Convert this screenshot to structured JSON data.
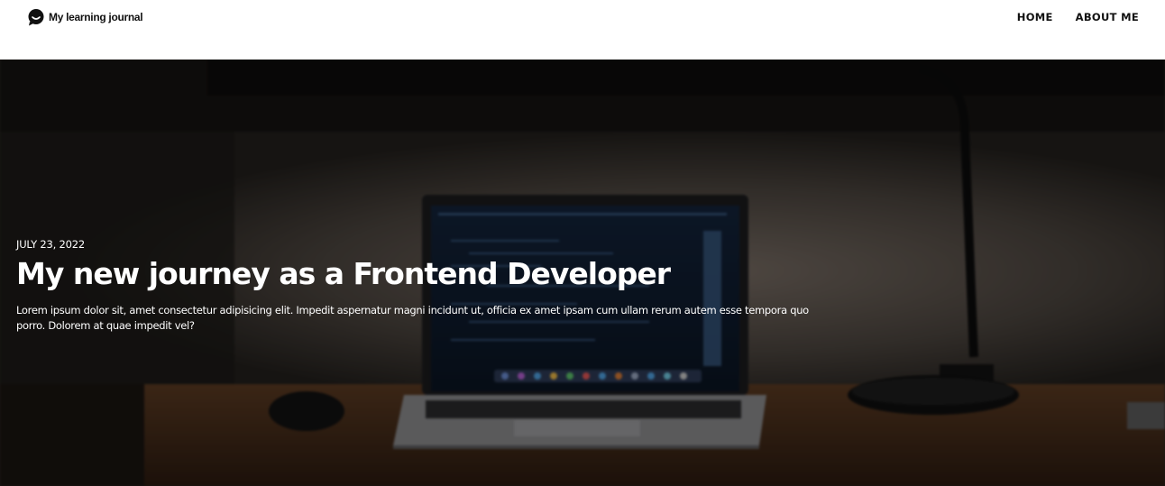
{
  "header": {
    "logo_text": "My learning journal",
    "logo_icon": "chat-bubble-icon",
    "nav": [
      {
        "label": "HOME"
      },
      {
        "label": "ABOUT ME"
      }
    ]
  },
  "hero": {
    "date": "JULY 23, 2022",
    "title": "My new journey as a Frontend Developer",
    "excerpt": "Lorem ipsum dolor sit, amet consectetur adipisicing elit. Impedit aspernatur magni incidunt ut, officia ex amet ipsam cum ullam rerum autem esse tempora quo porro. Dolorem at quae impedit vel?"
  }
}
